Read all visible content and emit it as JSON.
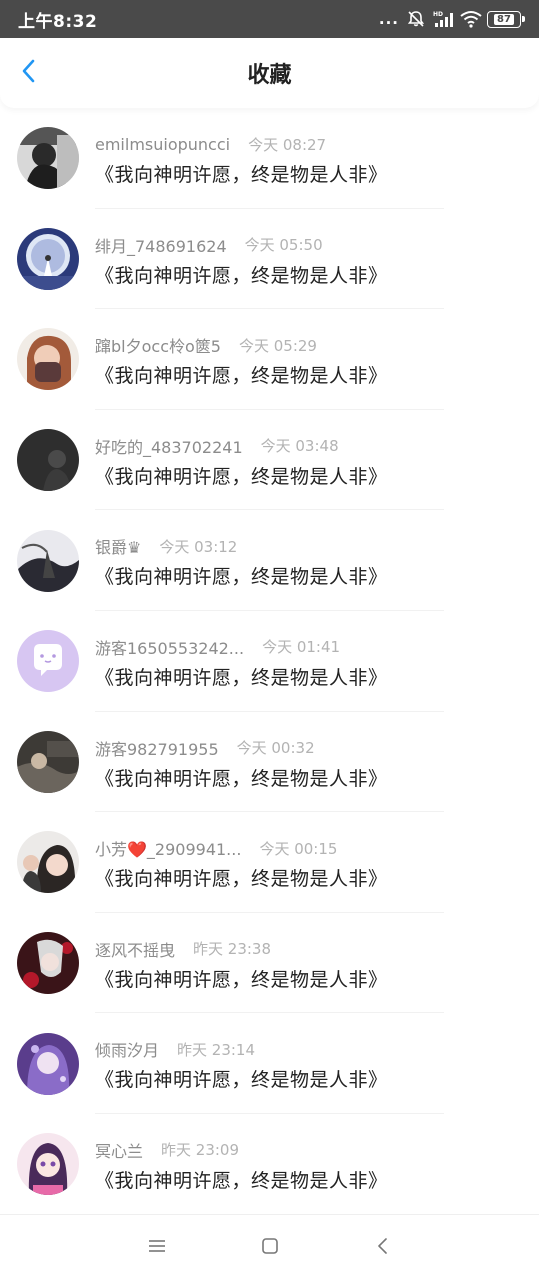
{
  "status_bar": {
    "time": "上午8:32",
    "dots": "...",
    "battery": "87",
    "icons": [
      "mute-bell-icon",
      "hd-signal-icon",
      "wifi-icon",
      "battery-icon"
    ]
  },
  "header": {
    "title": "收藏",
    "back_icon": "chevron-left-icon",
    "accent_color": "#2196f3"
  },
  "items": [
    {
      "name": "emilmsuiopuncci",
      "time": "今天 08:27",
      "content": "《我向神明许愿，终是物是人非》"
    },
    {
      "name": "绯月_748691624",
      "time": "今天 05:50",
      "content": "《我向神明许愿，终是物是人非》"
    },
    {
      "name": "蹿bl夕occ柃o篋5",
      "time": "今天 05:29",
      "content": "《我向神明许愿，终是物是人非》"
    },
    {
      "name": "好吃的_483702241",
      "time": "今天 03:48",
      "content": "《我向神明许愿，终是物是人非》"
    },
    {
      "name": "银爵♛",
      "time": "今天 03:12",
      "content": "《我向神明许愿，终是物是人非》"
    },
    {
      "name": "游客1650553242...",
      "time": "今天 01:41",
      "content": "《我向神明许愿，终是物是人非》"
    },
    {
      "name": "游客982791955",
      "time": "今天 00:32",
      "content": "《我向神明许愿，终是物是人非》"
    },
    {
      "name": "小芳❤️_2909941...",
      "time": "今天 00:15",
      "content": "《我向神明许愿，终是物是人非》"
    },
    {
      "name": "逐风不摇曳",
      "time": "昨天 23:38",
      "content": "《我向神明许愿，终是物是人非》"
    },
    {
      "name": "倾雨汐月",
      "time": "昨天 23:14",
      "content": "《我向神明许愿，终是物是人非》"
    },
    {
      "name": "冥心兰",
      "time": "昨天 23:09",
      "content": "《我向神明许愿，终是物是人非》"
    }
  ],
  "nav_bar": {
    "icons": [
      "menu-icon",
      "home-square-icon",
      "back-arrow-icon"
    ]
  }
}
